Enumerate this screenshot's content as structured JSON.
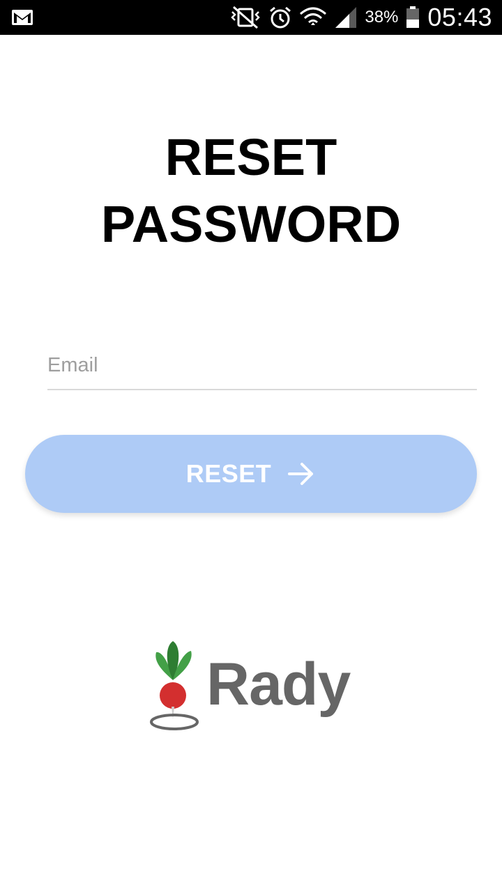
{
  "status_bar": {
    "battery_percent": "38%",
    "time": "05:43",
    "icons": [
      "gmail-icon",
      "mute-vibrate-icon",
      "alarm-icon",
      "wifi-icon",
      "signal-icon",
      "battery-icon"
    ]
  },
  "page": {
    "title_line1": "RESET",
    "title_line2": "PASSWORD"
  },
  "form": {
    "email_placeholder": "Email",
    "email_value": "",
    "reset_label": "RESET"
  },
  "logo": {
    "text": "Rady"
  },
  "colors": {
    "status_bar": "#000000",
    "background": "#ffffff",
    "button": "#aecbf6",
    "button_text": "#ffffff",
    "logo_text": "#666666",
    "logo_leaf_dark": "#2e7d32",
    "logo_leaf_light": "#43a047",
    "logo_radish": "#d32f2f"
  }
}
